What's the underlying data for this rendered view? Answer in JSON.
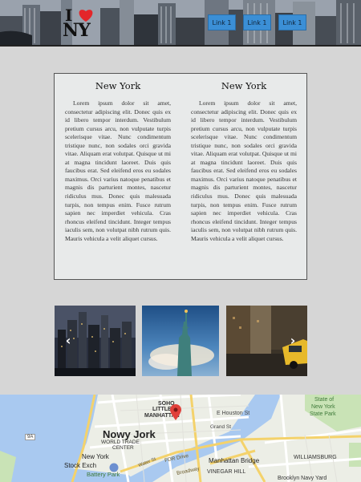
{
  "header": {
    "logo": {
      "i": "I",
      "ny": "NY"
    },
    "nav": [
      "Link 1",
      "Link 1",
      "Link 1"
    ]
  },
  "columns": [
    {
      "title": "New York",
      "text": "Lorem ipsum dolor sit amet, consectetur adipiscing elit. Donec quis ex id libero tempor interdum. Vestibulum pretium cursus arcu, non vulputate turpis scelerisque vitae. Nunc condimentum tristique nunc, non sodales orci gravida vitae. Aliquam erat volutpat. Quisque ut mi at magna tincidunt laoreet. Duis quis faucibus erat. Sed eleifend eros eu sodales maximus. Orci varius natoque penatibus et magnis dis parturient montes, nascetur ridiculus mus. Donec quis malesuada turpis, non tempus enim. Fusce rutrum sapien nec imperdiet vehicula. Cras rhoncus eleifend tincidunt. Integer tempus iaculis sem, non volutpat nibh rutrum quis. Mauris vehicula a velit aliquet cursus."
    },
    {
      "title": "New York",
      "text": "Lorem ipsum dolor sit amet, consectetur adipiscing elit. Donec quis ex id libero tempor interdum. Vestibulum pretium cursus arcu, non vulputate turpis scelerisque vitae. Nunc condimentum tristique nunc, non sodales orci gravida vitae. Aliquam erat volutpat. Quisque ut mi at magna tincidunt laoreet. Duis quis faucibus erat. Sed eleifend eros eu sodales maximus. Orci varius natoque penatibus et magnis dis parturient montes, nascetur ridiculus mus. Donec quis malesuada turpis, non tempus enim. Fusce rutrum sapien nec imperdiet vehicula. Cras rhoncus eleifend tincidunt. Integer tempus iaculis sem, non volutpat nibh rutrum quis. Mauris vehicula a velit aliquet cursus."
    }
  ],
  "carousel": {
    "prev_icon": "chevron-left-icon",
    "next_icon": "chevron-right-icon",
    "prev_glyph": "‹",
    "next_glyph": "›"
  },
  "map": {
    "labels": {
      "soho": "SOHO",
      "little": "LITTLE",
      "manhattan": "MANHATTAN",
      "houston": "E Houston St",
      "grand": "Grand St",
      "state_park_1": "State of",
      "state_park_2": "New York",
      "state_park_3": "State Park",
      "nowy_jork": "Nowy Jork",
      "wtc_1": "WORLD TRADE",
      "wtc_2": "CENTER",
      "new_york": "New York",
      "stock_exch": "Stock Exch",
      "battery_park": "Battery Park",
      "fdr": "FDR Drive",
      "manhattan_bridge": "Manhattan Bridge",
      "vinegar_hill": "VINEGAR HILL",
      "williamsburg": "WILLIAMSBURG",
      "brooklyn_navy": "Brooklyn Navy Yard",
      "water_st": "Water St",
      "broadway": "Broadway",
      "route": "9A"
    },
    "marker_color": "#e0403a"
  }
}
